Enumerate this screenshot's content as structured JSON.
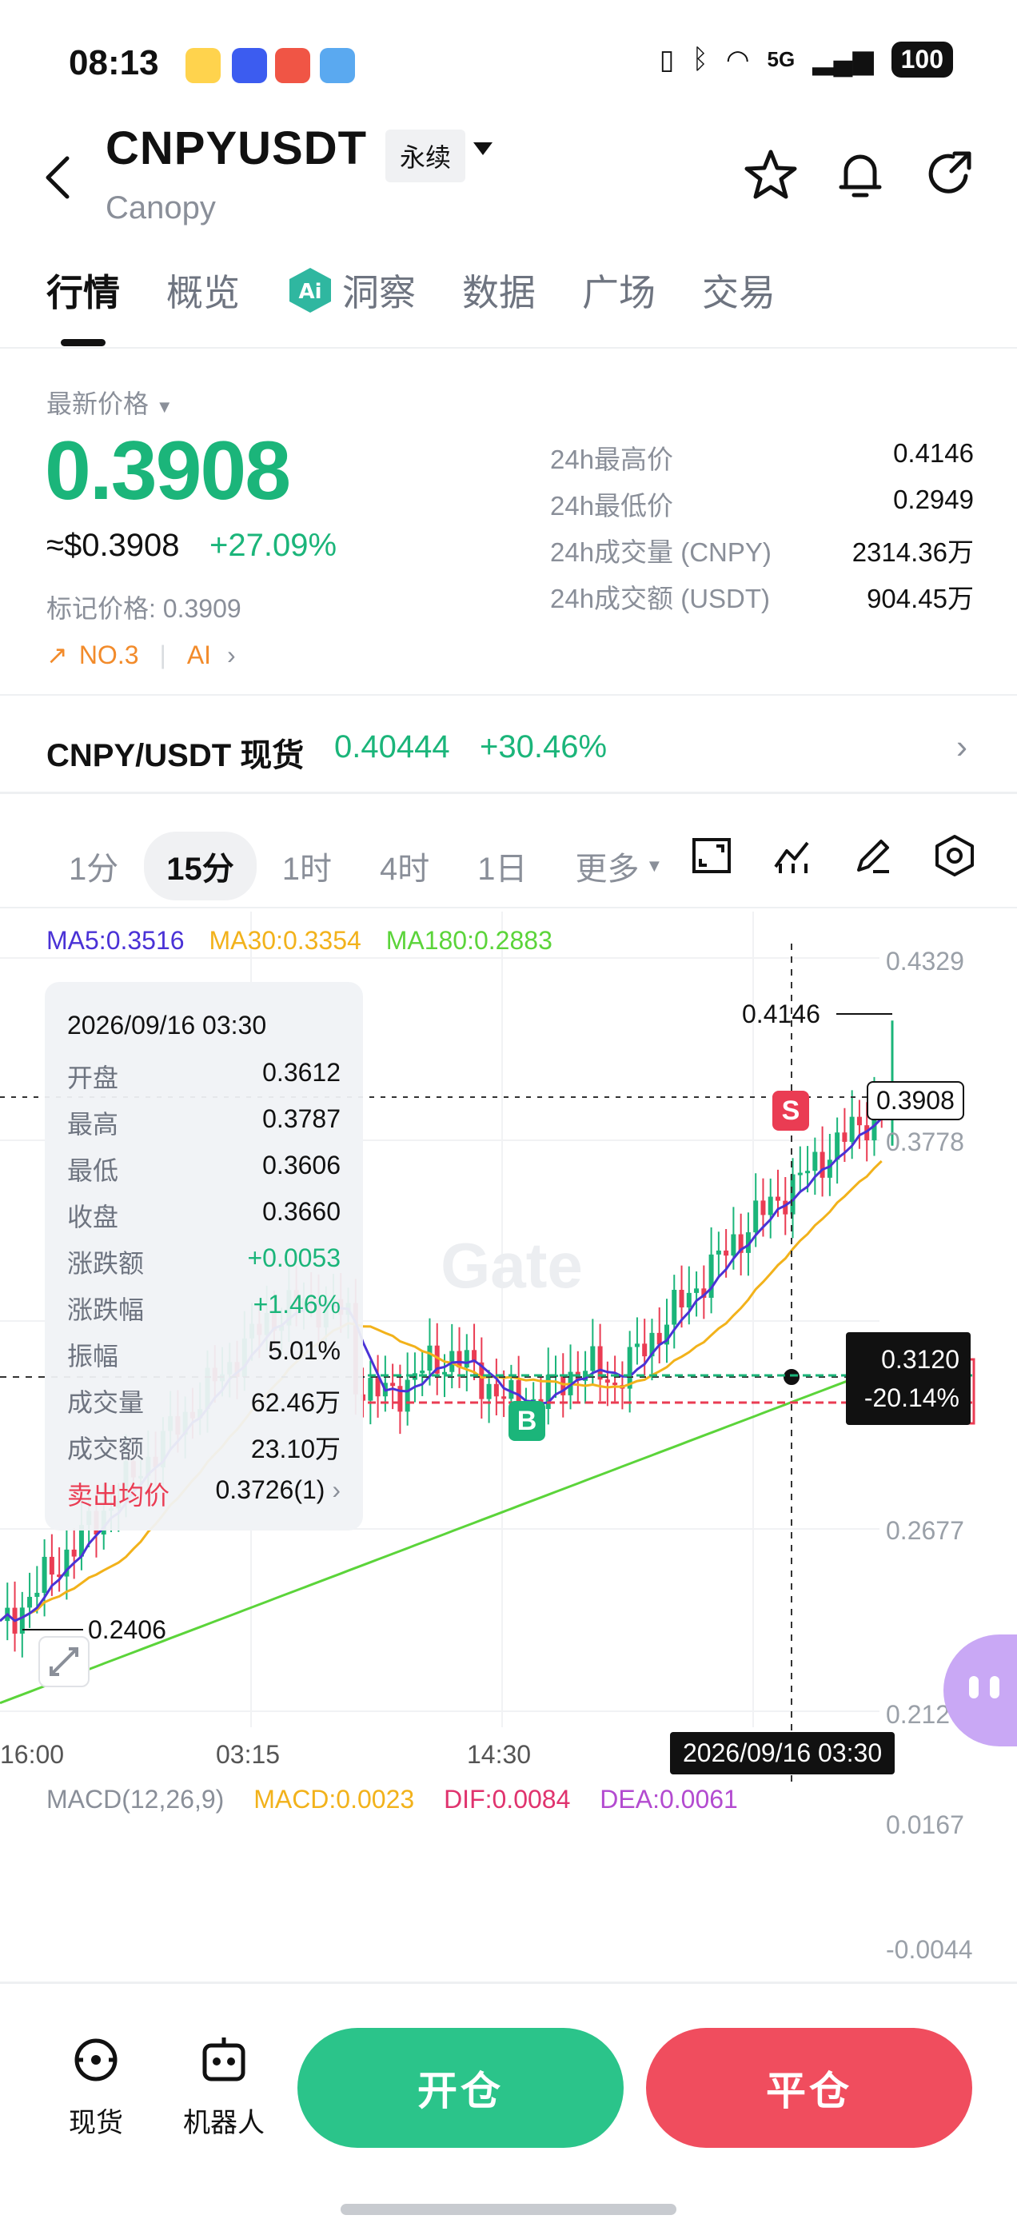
{
  "status_bar": {
    "time": "08:13",
    "network": "5G",
    "battery": "100"
  },
  "header": {
    "symbol": "CNPYUSDT",
    "contract_type": "永续",
    "name": "Canopy"
  },
  "tabs": [
    "行情",
    "概览",
    "洞察",
    "数据",
    "广场",
    "交易"
  ],
  "price": {
    "label": "最新价格",
    "last": "0.3908",
    "usd": "≈$0.3908",
    "change_pct": "+27.09%",
    "mark_price": "标记价格: 0.3909",
    "rank": "NO.3",
    "ai": "AI"
  },
  "stats": [
    {
      "k": "24h最高价",
      "v": "0.4146"
    },
    {
      "k": "24h最低价",
      "v": "0.2949"
    },
    {
      "k": "24h成交量 (CNPY)",
      "v": "2314.36万"
    },
    {
      "k": "24h成交额 (USDT)",
      "v": "904.45万"
    }
  ],
  "spot": {
    "pair": "CNPY/USDT 现货",
    "price": "0.40444",
    "change": "+30.46%"
  },
  "timeframes": [
    "1分",
    "15分",
    "1时",
    "4时",
    "1日",
    "更多"
  ],
  "active_timeframe": "15分",
  "ma_legend": {
    "ma5": "MA5:0.3516",
    "ma30": "MA30:0.3354",
    "ma180": "MA180:0.2883"
  },
  "tooltip": {
    "date": "2026/09/16 03:30",
    "rows": [
      {
        "k": "开盘",
        "v": "0.3612",
        "color": "#111111"
      },
      {
        "k": "最高",
        "v": "0.3787",
        "color": "#111111"
      },
      {
        "k": "最低",
        "v": "0.3606",
        "color": "#111111"
      },
      {
        "k": "收盘",
        "v": "0.3660",
        "color": "#111111"
      },
      {
        "k": "涨跌额",
        "v": "+0.0053",
        "color": "#1bb57a"
      },
      {
        "k": "涨跌幅",
        "v": "+1.46%",
        "color": "#1bb57a"
      },
      {
        "k": "振幅",
        "v": "5.01%",
        "color": "#111111"
      },
      {
        "k": "成交量",
        "v": "62.46万",
        "color": "#111111"
      },
      {
        "k": "成交额",
        "v": "23.10万",
        "color": "#111111"
      }
    ],
    "sell_avg_label": "卖出均价",
    "sell_avg_value": "0.3726(1)"
  },
  "axis": {
    "price_ticks": [
      "0.4329",
      "0.3778",
      "0.2677",
      "0.2126"
    ],
    "time_ticks": [
      "16:00",
      "03:15",
      "14:30"
    ],
    "high_label": "0.4146",
    "low_label": "0.2406",
    "current_price_box": "0.3908",
    "crosshair_price": "0.3120",
    "crosshair_pct": "-20.14%",
    "crosshair_date": "2026/09/16 03:30",
    "sell_marker": "S",
    "buy_marker": "B"
  },
  "macd": {
    "title": "MACD(12,26,9)",
    "macd": "MACD:0.0023",
    "dif": "DIF:0.0084",
    "dea": "DEA:0.0061",
    "ticks": [
      "0.0167",
      "-0.0044"
    ]
  },
  "colors": {
    "up": "#1bb57a",
    "down": "#ea3c53",
    "ma5": "#4a32d6",
    "ma30": "#f2b21b",
    "ma180": "#5bd43a",
    "dif": "#e0336e",
    "dea": "#b34bd0"
  },
  "bottom": {
    "spot_label": "现货",
    "bot_label": "机器人",
    "open_label": "开仓",
    "close_label": "平仓"
  }
}
